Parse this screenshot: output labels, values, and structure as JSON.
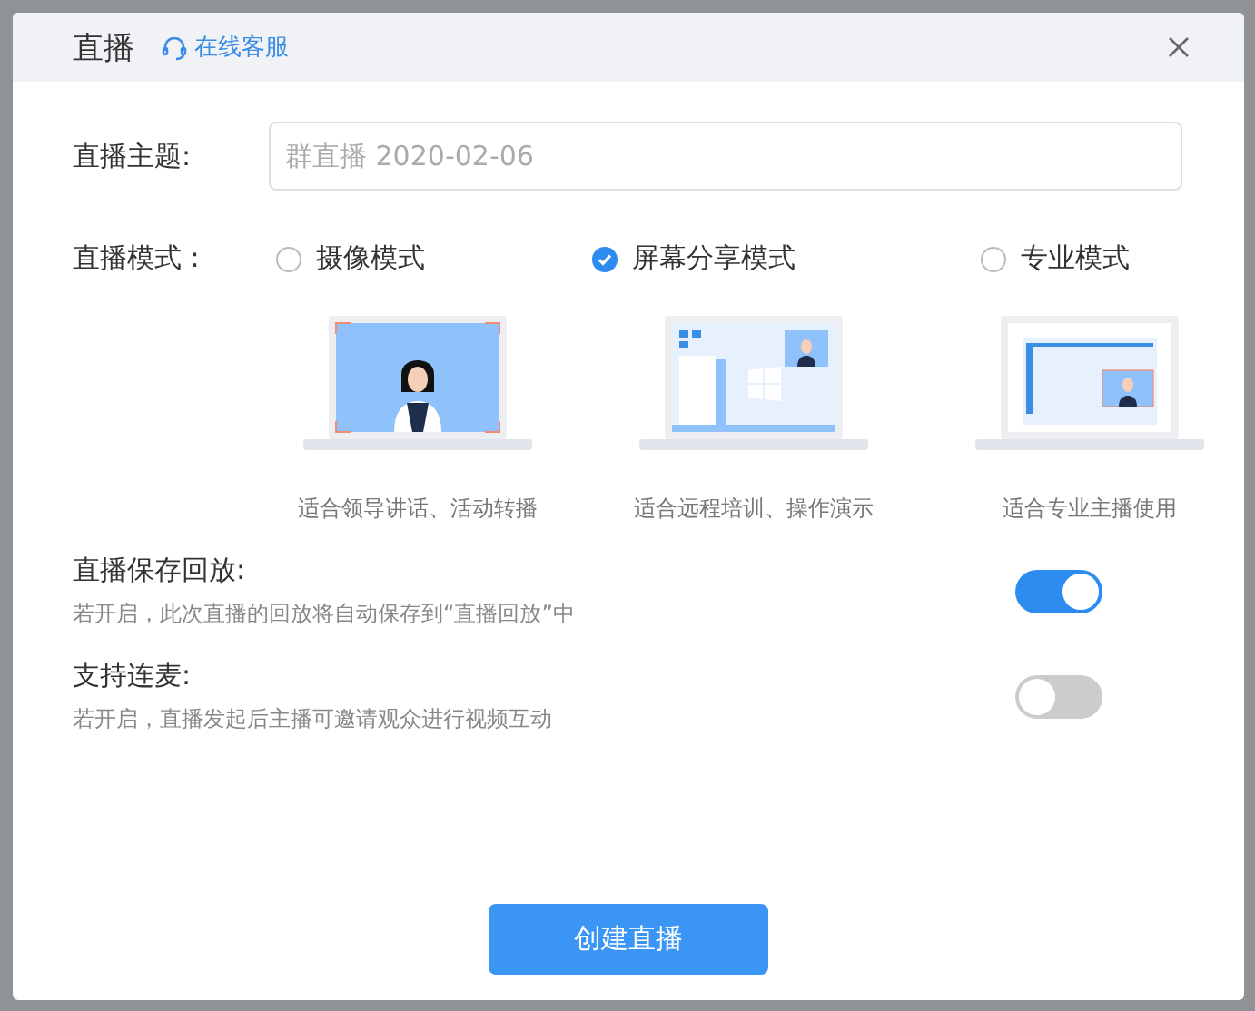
{
  "dialog": {
    "title": "直播",
    "support_link": "在线客服"
  },
  "topic": {
    "label": "直播主题:",
    "placeholder": "群直播 2020-02-06"
  },
  "mode": {
    "label": "直播模式 :",
    "options": [
      {
        "kind": "camera",
        "label": "摄像模式",
        "selected": false,
        "caption": "适合领导讲话、活动转播"
      },
      {
        "kind": "screen",
        "label": "屏幕分享模式",
        "selected": true,
        "caption": "适合远程培训、操作演示"
      },
      {
        "kind": "pro",
        "label": "专业模式",
        "selected": false,
        "caption": "适合专业主播使用"
      }
    ]
  },
  "settings": [
    {
      "title": "直播保存回放:",
      "description": "若开启，此次直播的回放将自动保存到“直播回放”中",
      "on": true
    },
    {
      "title": "支持连麦:",
      "description": "若开启，直播发起后主播可邀请观众进行视频互动",
      "on": false
    }
  ],
  "buttons": [
    "创建直播"
  ]
}
